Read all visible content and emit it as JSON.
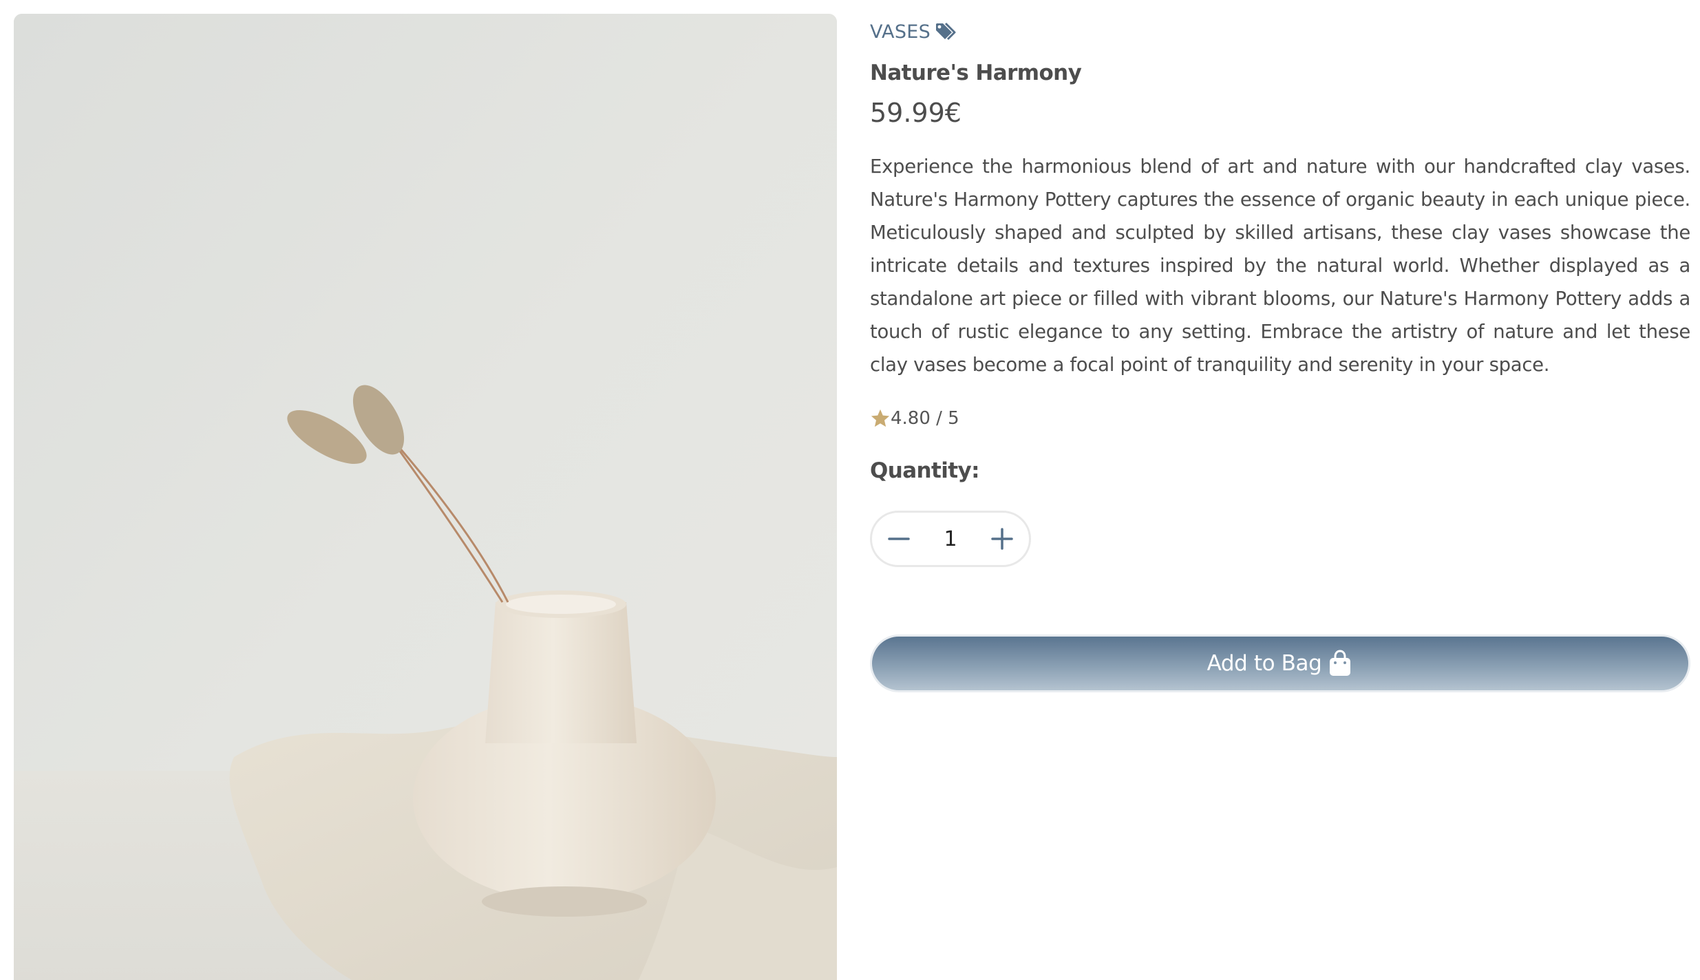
{
  "product": {
    "category": "VASES",
    "title": "Nature's Harmony",
    "price": "59.99€",
    "description": "Experience the harmonious blend of art and nature with our handcrafted clay vases. Nature's Harmony Pottery captures the essence of organic beauty in each unique piece. Meticulously shaped and sculpted by skilled artisans, these clay vases showcase the intricate details and textures inspired by the natural world. Whether displayed as a standalone art piece or filled with vibrant blooms, our Nature's Harmony Pottery adds a touch of rustic elegance to any setting. Embrace the artistry of nature and let these clay vases become a focal point of tranquility and serenity in your space.",
    "rating": "4.80 / 5",
    "image_alt": "cream clay vase with dried bunny tail grass on linen cloth"
  },
  "quantity": {
    "label": "Quantity:",
    "value": "1"
  },
  "actions": {
    "add_to_bag_label": "Add to Bag"
  },
  "icons": {
    "category": "tags-icon",
    "rating": "star-icon",
    "decrement": "minus-icon",
    "increment": "plus-icon",
    "add_to_bag": "shopping-bag-icon"
  },
  "colors": {
    "accent": "#55708a",
    "star": "#c9ab72",
    "button_gradient_top": "#5a7590",
    "button_gradient_bottom": "#b4c3d0",
    "text": "#4d4d4d"
  }
}
